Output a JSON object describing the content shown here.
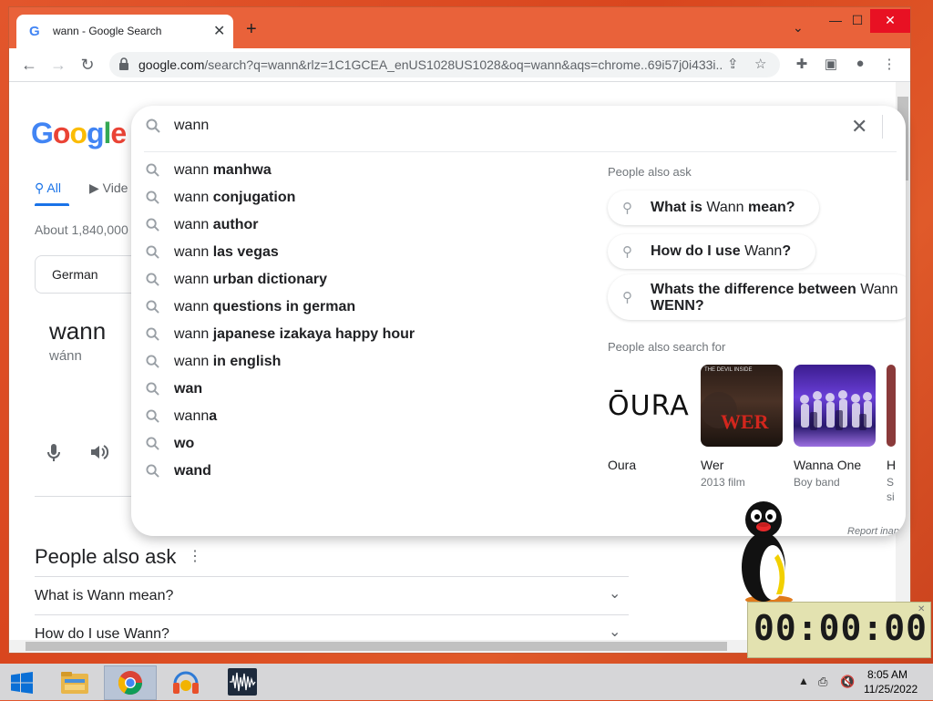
{
  "browser": {
    "tab_title": "wann - Google Search",
    "tab_close": "✕",
    "new_tab": "+",
    "url_host": "google.com",
    "url_rest": "/search?q=wann&rlz=1C1GCEA_enUS1028US1028&oq=wann&aqs=chrome..69i57j0i433i...",
    "window_controls": [
      "—",
      "☐",
      "✕"
    ]
  },
  "page": {
    "logo": [
      "G",
      "o",
      "o",
      "g",
      "l",
      "e"
    ],
    "logo_colors": [
      "#4285f4",
      "#ea4335",
      "#fbbc05",
      "#4285f4",
      "#34a853",
      "#ea4335"
    ],
    "tab_all": "All",
    "tab_videos": "Vide",
    "result_stats": "About 1,840,000",
    "language_chip": "German",
    "word": "wann",
    "phonetic": "wánn",
    "paa_heading": "People also ask",
    "paa_questions": [
      "What is Wann mean?",
      "How do I use Wann?"
    ]
  },
  "search": {
    "query": "wann",
    "suggestions": [
      {
        "prefix": "wann ",
        "bold": "manhwa"
      },
      {
        "prefix": "wann ",
        "bold": "conjugation"
      },
      {
        "prefix": "wann ",
        "bold": "author"
      },
      {
        "prefix": "wann ",
        "bold": "las vegas"
      },
      {
        "prefix": "wann ",
        "bold": "urban dictionary"
      },
      {
        "prefix": "wann ",
        "bold": "questions in german"
      },
      {
        "prefix": "wann ",
        "bold": "japanese izakaya happy hour"
      },
      {
        "prefix": "wann ",
        "bold": "in english"
      },
      {
        "prefix": "",
        "bold": "wan"
      },
      {
        "prefix": "wann",
        "bold": "a"
      },
      {
        "prefix": "",
        "bold": "wo"
      },
      {
        "prefix": "",
        "bold": "wand"
      }
    ],
    "side_paa_heading": "People also ask",
    "side_paa": [
      {
        "bold1": "What is ",
        "normal": "Wann",
        "bold2": " mean?"
      },
      {
        "bold1": "How do I use ",
        "normal": "Wann",
        "bold2": "?"
      },
      {
        "bold1": "Whats the difference between ",
        "normal": "Wann",
        "bold2": "",
        "line2": "WENN?"
      }
    ],
    "side_search_heading": "People also search for",
    "cards": [
      {
        "title": "Oura",
        "subtitle": "",
        "logo_text": "ŌURA"
      },
      {
        "title": "Wer",
        "subtitle": "2013 film",
        "img_text": "WER",
        "img_caption": "THE DEVIL INSIDE"
      },
      {
        "title": "Wanna One",
        "subtitle": "Boy band"
      },
      {
        "title": "H",
        "subtitle": "S",
        "subtitle2": "si"
      }
    ],
    "report": "Report inap"
  },
  "timer": {
    "display": "00:00:00"
  },
  "taskbar": {
    "time": "8:05 AM",
    "date": "11/25/2022"
  }
}
